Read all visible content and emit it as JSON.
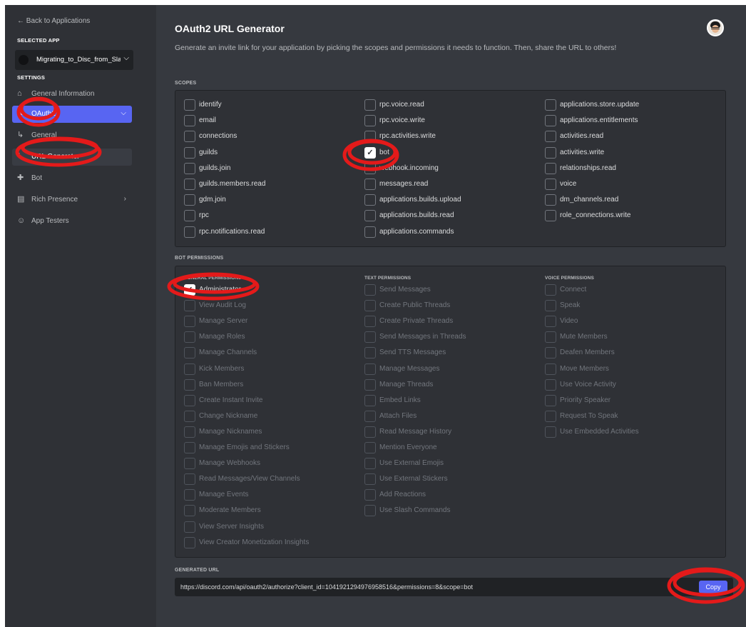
{
  "sidebar": {
    "back_label": "← Back to Applications",
    "selected_app_heading": "SELECTED APP",
    "app_name": "Migrating_to_Disc_from_Sla",
    "settings_heading": "SETTINGS",
    "items": [
      {
        "label": "General Information",
        "icon": "home-icon"
      },
      {
        "label": "OAuth2",
        "icon": "wrench-icon"
      },
      {
        "label": "General",
        "icon": "sub-arrow-icon"
      },
      {
        "label": "URL Generator",
        "icon": "sub-arrow-icon"
      },
      {
        "label": "Bot",
        "icon": "puzzle-icon"
      },
      {
        "label": "Rich Presence",
        "icon": "document-icon"
      },
      {
        "label": "App Testers",
        "icon": "person-check-icon"
      }
    ]
  },
  "main": {
    "title": "OAuth2 URL Generator",
    "description": "Generate an invite link for your application by picking the scopes and permissions it needs to function. Then, share the URL to others!",
    "scopes_label": "SCOPES",
    "scopes": [
      [
        {
          "label": "identify",
          "checked": false
        },
        {
          "label": "email",
          "checked": false
        },
        {
          "label": "connections",
          "checked": false
        },
        {
          "label": "guilds",
          "checked": false
        },
        {
          "label": "guilds.join",
          "checked": false
        },
        {
          "label": "guilds.members.read",
          "checked": false
        },
        {
          "label": "gdm.join",
          "checked": false
        },
        {
          "label": "rpc",
          "checked": false
        },
        {
          "label": "rpc.notifications.read",
          "checked": false
        }
      ],
      [
        {
          "label": "rpc.voice.read",
          "checked": false
        },
        {
          "label": "rpc.voice.write",
          "checked": false
        },
        {
          "label": "rpc.activities.write",
          "checked": false
        },
        {
          "label": "bot",
          "checked": true
        },
        {
          "label": "webhook.incoming",
          "checked": false
        },
        {
          "label": "messages.read",
          "checked": false
        },
        {
          "label": "applications.builds.upload",
          "checked": false
        },
        {
          "label": "applications.builds.read",
          "checked": false
        },
        {
          "label": "applications.commands",
          "checked": false
        }
      ],
      [
        {
          "label": "applications.store.update",
          "checked": false
        },
        {
          "label": "applications.entitlements",
          "checked": false
        },
        {
          "label": "activities.read",
          "checked": false
        },
        {
          "label": "activities.write",
          "checked": false
        },
        {
          "label": "relationships.read",
          "checked": false
        },
        {
          "label": "voice",
          "checked": false
        },
        {
          "label": "dm_channels.read",
          "checked": false
        },
        {
          "label": "role_connections.write",
          "checked": false
        }
      ]
    ],
    "bot_permissions_label": "BOT PERMISSIONS",
    "permission_columns": [
      {
        "heading": "GENERAL PERMISSIONS",
        "items": [
          {
            "label": "Administrator",
            "checked": true,
            "enabled": true
          },
          {
            "label": "View Audit Log",
            "checked": false,
            "enabled": false
          },
          {
            "label": "Manage Server",
            "checked": false,
            "enabled": false
          },
          {
            "label": "Manage Roles",
            "checked": false,
            "enabled": false
          },
          {
            "label": "Manage Channels",
            "checked": false,
            "enabled": false
          },
          {
            "label": "Kick Members",
            "checked": false,
            "enabled": false
          },
          {
            "label": "Ban Members",
            "checked": false,
            "enabled": false
          },
          {
            "label": "Create Instant Invite",
            "checked": false,
            "enabled": false
          },
          {
            "label": "Change Nickname",
            "checked": false,
            "enabled": false
          },
          {
            "label": "Manage Nicknames",
            "checked": false,
            "enabled": false
          },
          {
            "label": "Manage Emojis and Stickers",
            "checked": false,
            "enabled": false
          },
          {
            "label": "Manage Webhooks",
            "checked": false,
            "enabled": false
          },
          {
            "label": "Read Messages/View Channels",
            "checked": false,
            "enabled": false
          },
          {
            "label": "Manage Events",
            "checked": false,
            "enabled": false
          },
          {
            "label": "Moderate Members",
            "checked": false,
            "enabled": false
          },
          {
            "label": "View Server Insights",
            "checked": false,
            "enabled": false
          },
          {
            "label": "View Creator Monetization Insights",
            "checked": false,
            "enabled": false
          }
        ]
      },
      {
        "heading": "TEXT PERMISSIONS",
        "items": [
          {
            "label": "Send Messages",
            "checked": false,
            "enabled": false
          },
          {
            "label": "Create Public Threads",
            "checked": false,
            "enabled": false
          },
          {
            "label": "Create Private Threads",
            "checked": false,
            "enabled": false
          },
          {
            "label": "Send Messages in Threads",
            "checked": false,
            "enabled": false
          },
          {
            "label": "Send TTS Messages",
            "checked": false,
            "enabled": false
          },
          {
            "label": "Manage Messages",
            "checked": false,
            "enabled": false
          },
          {
            "label": "Manage Threads",
            "checked": false,
            "enabled": false
          },
          {
            "label": "Embed Links",
            "checked": false,
            "enabled": false
          },
          {
            "label": "Attach Files",
            "checked": false,
            "enabled": false
          },
          {
            "label": "Read Message History",
            "checked": false,
            "enabled": false
          },
          {
            "label": "Mention Everyone",
            "checked": false,
            "enabled": false
          },
          {
            "label": "Use External Emojis",
            "checked": false,
            "enabled": false
          },
          {
            "label": "Use External Stickers",
            "checked": false,
            "enabled": false
          },
          {
            "label": "Add Reactions",
            "checked": false,
            "enabled": false
          },
          {
            "label": "Use Slash Commands",
            "checked": false,
            "enabled": false
          }
        ]
      },
      {
        "heading": "VOICE PERMISSIONS",
        "items": [
          {
            "label": "Connect",
            "checked": false,
            "enabled": false
          },
          {
            "label": "Speak",
            "checked": false,
            "enabled": false
          },
          {
            "label": "Video",
            "checked": false,
            "enabled": false
          },
          {
            "label": "Mute Members",
            "checked": false,
            "enabled": false
          },
          {
            "label": "Deafen Members",
            "checked": false,
            "enabled": false
          },
          {
            "label": "Move Members",
            "checked": false,
            "enabled": false
          },
          {
            "label": "Use Voice Activity",
            "checked": false,
            "enabled": false
          },
          {
            "label": "Priority Speaker",
            "checked": false,
            "enabled": false
          },
          {
            "label": "Request To Speak",
            "checked": false,
            "enabled": false
          },
          {
            "label": "Use Embedded Activities",
            "checked": false,
            "enabled": false
          }
        ]
      }
    ],
    "generated_url_label": "GENERATED URL",
    "generated_url": "https://discord.com/api/oauth2/authorize?client_id=1041921294976958516&permissions=8&scope=bot",
    "copy_label": "Copy"
  },
  "colors": {
    "accent": "#5865f2",
    "background": "#36393f",
    "sidebar": "#2f3136",
    "annotation": "#e41a1a"
  }
}
